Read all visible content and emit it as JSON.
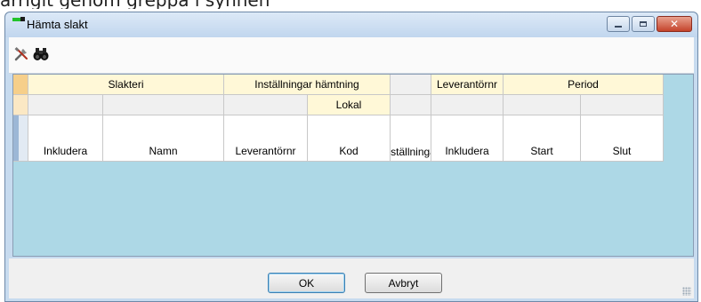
{
  "background_text": "arrigit genom greppa i synnen",
  "window": {
    "title": "Hämta slakt",
    "controls": {
      "minimize_icon": "minimize-icon",
      "maximize_icon": "maximize-icon",
      "close_icon": "close-icon"
    }
  },
  "toolbar": {
    "items": [
      {
        "icon": "tools-icon"
      },
      {
        "icon": "binoculars-icon"
      }
    ]
  },
  "grid": {
    "group_headers": [
      "Slakteri",
      "Inställningar hämtning",
      "",
      "Leverantörnr",
      "Period"
    ],
    "sub_header": {
      "lokal": "Lokal"
    },
    "columns": [
      "Inkludera",
      "Namn",
      "Leverantörnr",
      "Kod",
      "Inställningar",
      "Inkludera",
      "Start",
      "Slut"
    ],
    "rows": []
  },
  "buttons": {
    "ok": "OK",
    "cancel": "Avbryt"
  },
  "colors": {
    "grid_background": "#add8e6",
    "group_header_bg": "#fff8d7",
    "selected_row_header": "#f6cf8a",
    "title_bar": "#c7dbef"
  }
}
